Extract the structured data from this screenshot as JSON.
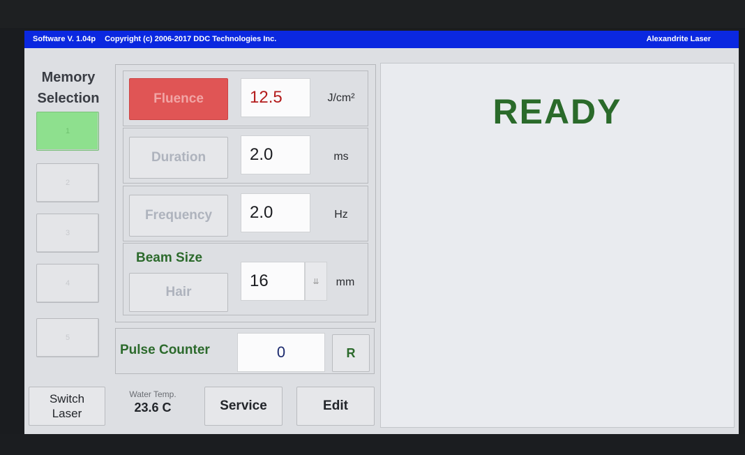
{
  "titlebar": {
    "software": "Software V. 1.04p",
    "copyright": "Copyright (c) 2006-2017 DDC Technologies Inc.",
    "laser_name": "Alexandrite Laser"
  },
  "memory": {
    "title_line1": "Memory",
    "title_line2": "Selection",
    "slots": [
      "1",
      "2",
      "3",
      "4",
      "5"
    ],
    "active_slot": "1"
  },
  "params": {
    "fluence": {
      "label": "Fluence",
      "value": "12.5",
      "unit": "J/cm²"
    },
    "duration": {
      "label": "Duration",
      "value": "2.0",
      "unit": "ms"
    },
    "frequency": {
      "label": "Frequency",
      "value": "2.0",
      "unit": "Hz"
    },
    "beam": {
      "title": "Beam Size",
      "mode_label": "Hair",
      "value": "16",
      "unit": "mm",
      "dropdown_glyph": "⇊"
    }
  },
  "pulse": {
    "label": "Pulse Counter",
    "value": "0",
    "reset_label": "R"
  },
  "bottom": {
    "switch_line1": "Switch",
    "switch_line2": "Laser",
    "water_label": "Water Temp.",
    "water_value": "23.6 C",
    "service": "Service",
    "edit": "Edit"
  },
  "status": {
    "text": "READY",
    "color": "#2a6a2a"
  },
  "colors": {
    "titlebar": "#0b28e0",
    "fluence_active": "#e05555",
    "memory_active": "#8ee08e"
  }
}
